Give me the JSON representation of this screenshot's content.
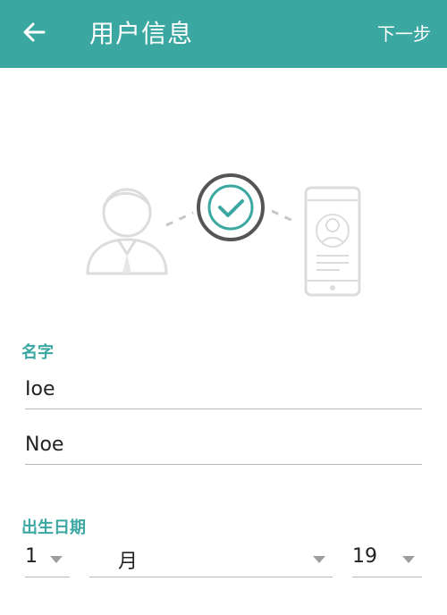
{
  "appbar": {
    "title": "用户信息",
    "next_label": "下一步",
    "back_icon": "arrow-left-icon",
    "color": "#3aa7a1"
  },
  "illustration": {
    "icons": [
      "person-avatar-icon",
      "check-circle-icon",
      "phone-profile-icon"
    ]
  },
  "form": {
    "name_label": "名字",
    "first_name_value": "Ioe",
    "last_name_value": "Noe",
    "dob_label": "出生日期",
    "day_value": "1",
    "month_value": "月",
    "year_value": "19"
  }
}
